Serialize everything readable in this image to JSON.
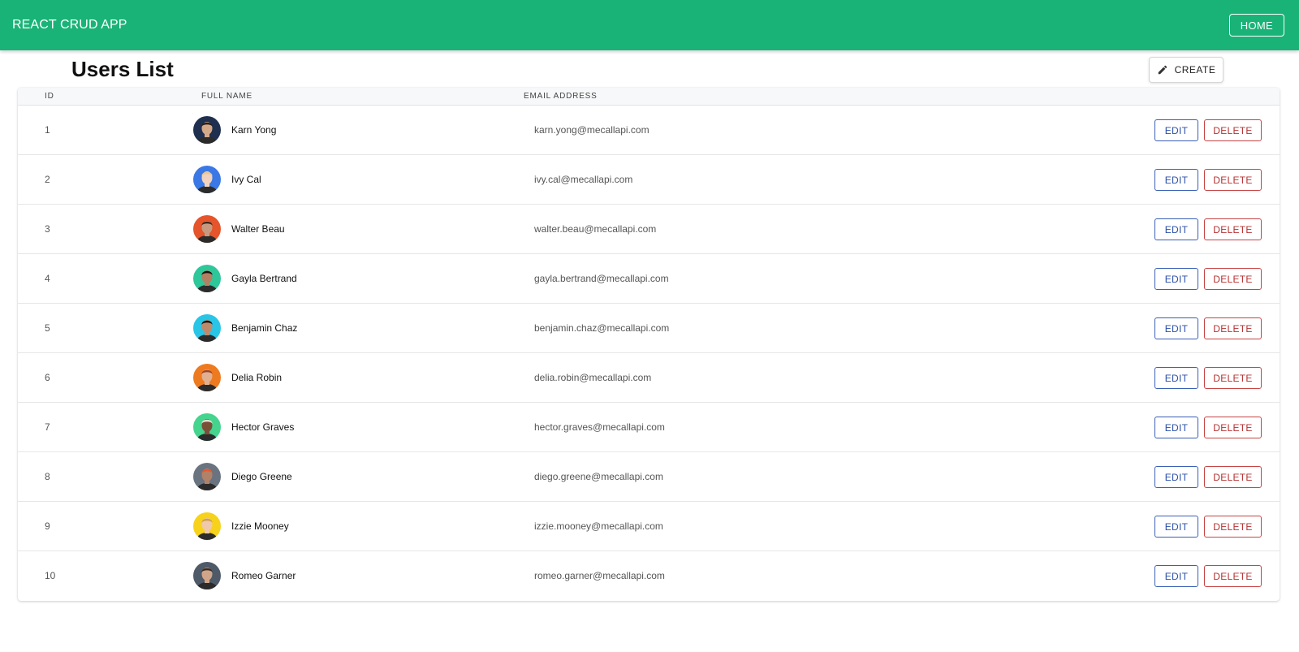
{
  "appbar": {
    "title": "REACT CRUD APP",
    "home_label": "HOME",
    "color": "#19b377"
  },
  "page": {
    "title": "Users List",
    "create_label": "CREATE",
    "create_icon": "pencil-icon"
  },
  "table": {
    "headers": {
      "id": "ID",
      "full_name": "FULL NAME",
      "email": "EMAIL ADDRESS"
    },
    "edit_label": "EDIT",
    "delete_label": "DELETE",
    "rows": [
      {
        "id": "1",
        "name": "Karn Yong",
        "email": "karn.yong@mecallapi.com",
        "avatar_bg": "#1f2f4f",
        "avatar_skin": "#d4a98a",
        "avatar_hair": "#2a1e18"
      },
      {
        "id": "2",
        "name": "Ivy Cal",
        "email": "ivy.cal@mecallapi.com",
        "avatar_bg": "#3a78e6",
        "avatar_skin": "#f1d2bf",
        "avatar_hair": "#e9c690"
      },
      {
        "id": "3",
        "name": "Walter Beau",
        "email": "walter.beau@mecallapi.com",
        "avatar_bg": "#e5542a",
        "avatar_skin": "#c79a80",
        "avatar_hair": "#3d2a20"
      },
      {
        "id": "4",
        "name": "Gayla Bertrand",
        "email": "gayla.bertrand@mecallapi.com",
        "avatar_bg": "#2ec79a",
        "avatar_skin": "#b27f62",
        "avatar_hair": "#1b120d"
      },
      {
        "id": "5",
        "name": "Benjamin Chaz",
        "email": "benjamin.chaz@mecallapi.com",
        "avatar_bg": "#29c5e6",
        "avatar_skin": "#c08a6a",
        "avatar_hair": "#1b1511"
      },
      {
        "id": "6",
        "name": "Delia Robin",
        "email": "delia.robin@mecallapi.com",
        "avatar_bg": "#ee7a1f",
        "avatar_skin": "#e1b091",
        "avatar_hair": "#a0442a"
      },
      {
        "id": "7",
        "name": "Hector Graves",
        "email": "hector.graves@mecallapi.com",
        "avatar_bg": "#45d48e",
        "avatar_skin": "#7a4f38",
        "avatar_hair": "#e6e1d3"
      },
      {
        "id": "8",
        "name": "Diego Greene",
        "email": "diego.greene@mecallapi.com",
        "avatar_bg": "#6a7480",
        "avatar_skin": "#b0826a",
        "avatar_hair": "#e8572b"
      },
      {
        "id": "9",
        "name": "Izzie Mooney",
        "email": "izzie.mooney@mecallapi.com",
        "avatar_bg": "#f7d21a",
        "avatar_skin": "#f0c8aa",
        "avatar_hair": "#caa05a"
      },
      {
        "id": "10",
        "name": "Romeo Garner",
        "email": "romeo.garner@mecallapi.com",
        "avatar_bg": "#4e5a68",
        "avatar_skin": "#d1a58a",
        "avatar_hair": "#3b2a22"
      }
    ]
  }
}
